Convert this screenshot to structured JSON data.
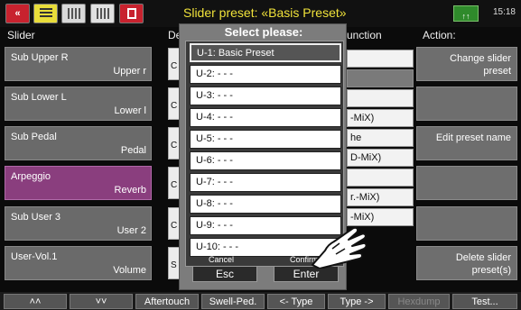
{
  "topbar": {
    "back_icon": "double-left-chevron-icon",
    "title": "Slider preset: «Basis Preset»",
    "tempo_label": "↑↑",
    "clock": "15:18"
  },
  "columns": {
    "slider": "Slider",
    "de": "De",
    "function": "unction",
    "action": "Action:"
  },
  "sliders": [
    {
      "name": "Sub Upper R",
      "sub": "Upper r"
    },
    {
      "name": "Sub Lower L",
      "sub": "Lower l"
    },
    {
      "name": "Sub Pedal",
      "sub": "Pedal"
    },
    {
      "name": "Arpeggio",
      "sub": "Reverb",
      "selected": true
    },
    {
      "name": "Sub User 3",
      "sub": "User 2"
    },
    {
      "name": "User-Vol.1",
      "sub": "Volume"
    }
  ],
  "mid_fields": [
    "C",
    "C",
    "C",
    "C",
    "C",
    "S"
  ],
  "function_fields": [
    "",
    "",
    "",
    "-MiX)",
    "he",
    "D-MiX)",
    "",
    "r.-MiX)",
    "-MiX)"
  ],
  "actions": [
    {
      "label": "Change slider preset"
    },
    {
      "label": ""
    },
    {
      "label": "Edit preset name"
    },
    {
      "label": ""
    },
    {
      "label": ""
    },
    {
      "label": "Delete slider preset(s)"
    }
  ],
  "bottombar": {
    "up_icon": "«",
    "down_icon": "»",
    "aftertouch": "Aftertouch",
    "swell": "Swell-Ped.",
    "type_left": "<- Type",
    "type_right": "Type ->",
    "hexdump": "Hexdump",
    "test": "Test..."
  },
  "popup": {
    "title": "Select please:",
    "items": [
      "U-1: Basic Preset",
      "U-2: - - -",
      "U-3: - - -",
      "U-4: - - -",
      "U-5: - - -",
      "U-6: - - -",
      "U-7: - - -",
      "U-8: - - -",
      "U-9: - - -",
      "U-10: - - -"
    ],
    "selected_index": 0,
    "cancel_label": "Cancel",
    "cancel_button": "Esc",
    "confirm_label": "Confirm",
    "confirm_button": "Enter"
  },
  "colors": {
    "selected_slider": "#8a3e7e",
    "title": "#f0e23a",
    "back": "#c8222e"
  }
}
